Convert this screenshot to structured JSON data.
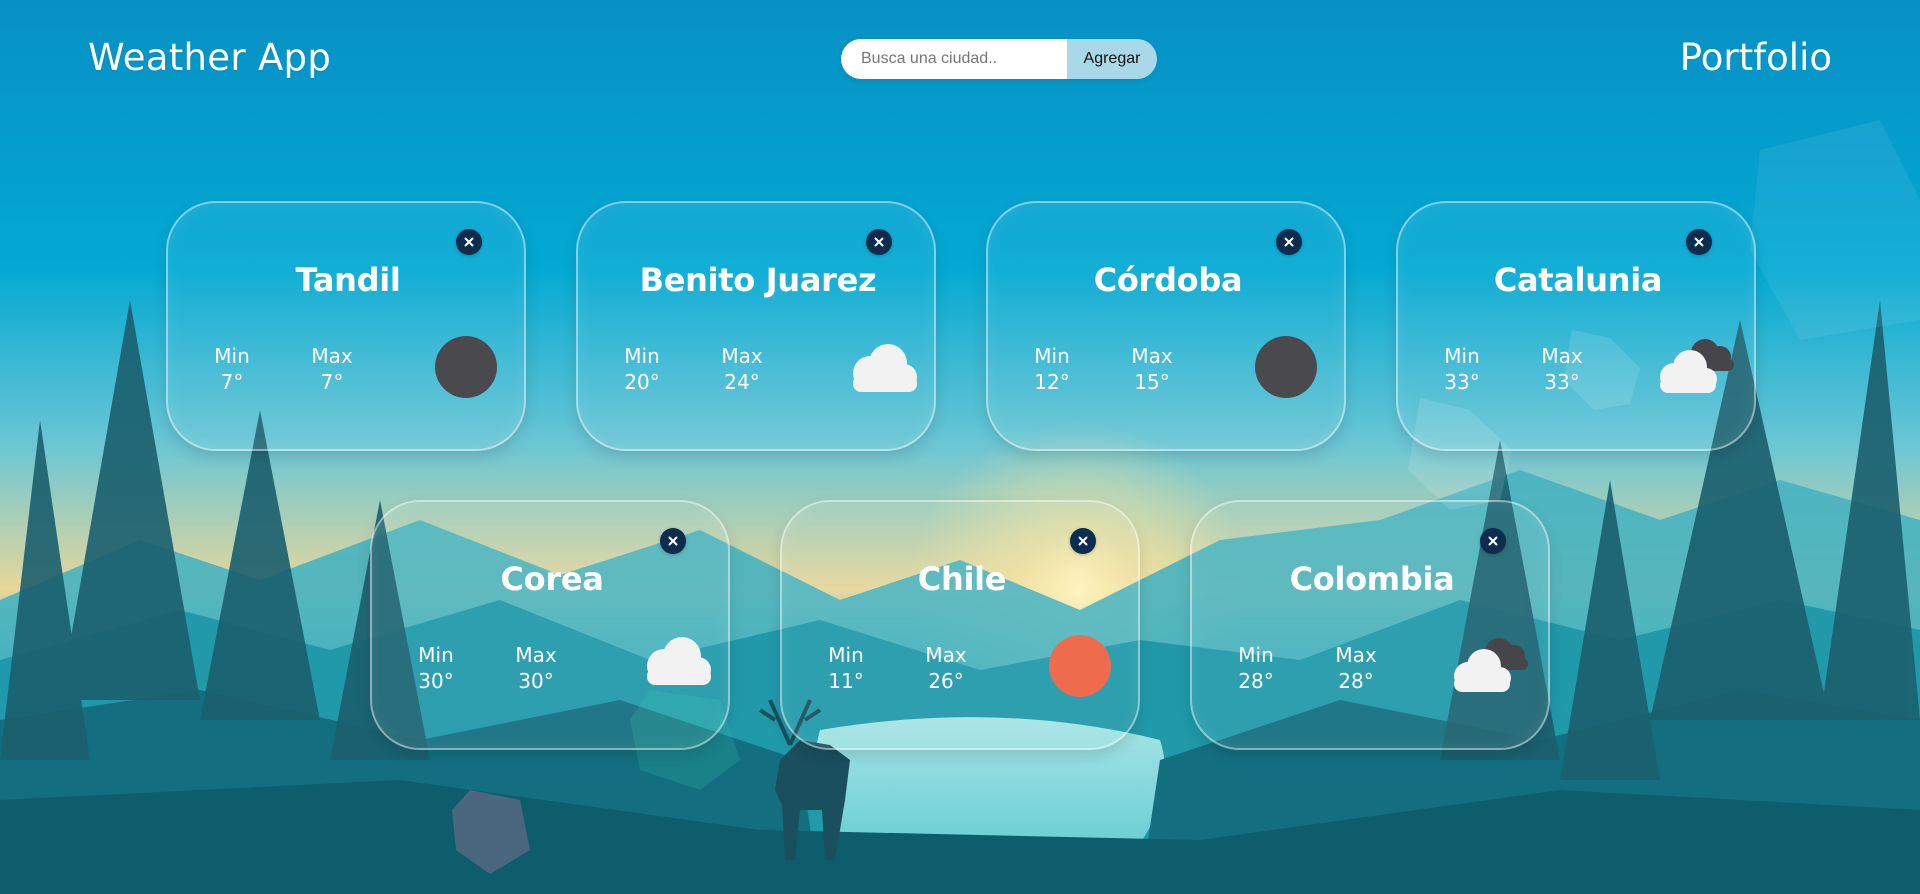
{
  "header": {
    "title": "Weather App",
    "portfolio_label": "Portfolio",
    "search": {
      "placeholder": "Busca una ciudad..",
      "value": "",
      "button_label": "Agregar"
    }
  },
  "colors": {
    "close_button": "#0e2c4d",
    "button_bg": "#a9d8e8",
    "icon_dark": "#4a4a4e",
    "icon_sun": "#ee6c4d",
    "icon_cloud": "#f2f2f2"
  },
  "labels": {
    "min": "Min",
    "max": "Max"
  },
  "cities": [
    {
      "name": "Tandil",
      "min": "7°",
      "max": "7°",
      "icon": "dark-circle-icon"
    },
    {
      "name": "Benito Juarez",
      "min": "20°",
      "max": "24°",
      "icon": "cloud-icon"
    },
    {
      "name": "Córdoba",
      "min": "12°",
      "max": "15°",
      "icon": "dark-circle-icon"
    },
    {
      "name": "Catalunia",
      "min": "33°",
      "max": "33°",
      "icon": "storm-clouds-icon"
    },
    {
      "name": "Corea",
      "min": "30°",
      "max": "30°",
      "icon": "cloud-icon"
    },
    {
      "name": "Chile",
      "min": "11°",
      "max": "26°",
      "icon": "sun-icon"
    },
    {
      "name": "Colombia",
      "min": "28°",
      "max": "28°",
      "icon": "storm-clouds-icon"
    }
  ]
}
